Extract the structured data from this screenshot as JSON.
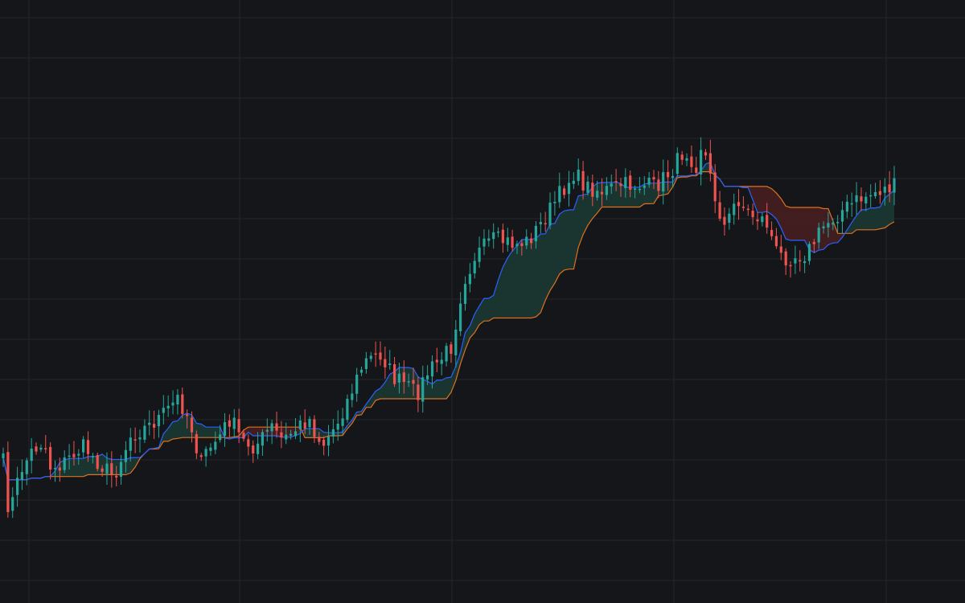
{
  "theme": {
    "background": "#151619",
    "grid": "#22252b",
    "up": "#26a69a",
    "down": "#ef5350",
    "fast_line": "#2962ff",
    "slow_line": "#e0701f",
    "bull_cloud": "#1b3a35",
    "bear_cloud": "#4a1f22"
  },
  "chart_data": {
    "type": "candlestick",
    "title": "",
    "xlabel": "",
    "ylabel": "",
    "bar_count": 190,
    "grid": true,
    "price_range": [
      0,
      750
    ],
    "series": [
      {
        "kind": "candles"
      },
      {
        "kind": "line",
        "role": "fast",
        "color": "#2962ff"
      },
      {
        "kind": "line",
        "role": "slow",
        "color": "#e0701f"
      },
      {
        "kind": "cloud",
        "between": [
          "fast",
          "slow"
        ]
      }
    ],
    "anchors": [
      [
        0,
        575
      ],
      [
        2,
        640
      ],
      [
        6,
        585
      ],
      [
        10,
        560
      ],
      [
        14,
        548
      ],
      [
        16,
        580
      ],
      [
        20,
        578
      ],
      [
        24,
        565
      ],
      [
        28,
        555
      ],
      [
        30,
        565
      ],
      [
        34,
        580
      ],
      [
        38,
        592
      ],
      [
        44,
        540
      ],
      [
        50,
        530
      ],
      [
        56,
        512
      ],
      [
        60,
        495
      ],
      [
        64,
        522
      ],
      [
        68,
        578
      ],
      [
        70,
        560
      ],
      [
        74,
        545
      ],
      [
        78,
        520
      ],
      [
        82,
        548
      ],
      [
        86,
        555
      ],
      [
        88,
        550
      ],
      [
        92,
        530
      ],
      [
        96,
        548
      ],
      [
        100,
        535
      ],
      [
        105,
        520
      ],
      [
        108,
        545
      ],
      [
        110,
        552
      ],
      [
        114,
        530
      ],
      [
        118,
        500
      ],
      [
        124,
        450
      ],
      [
        130,
        440
      ],
      [
        134,
        470
      ],
      [
        138,
        478
      ],
      [
        142,
        490
      ],
      [
        146,
        462
      ],
      [
        150,
        448
      ],
      [
        154,
        430
      ],
      [
        158,
        350
      ],
      [
        162,
        318
      ],
      [
        168,
        298
      ],
      [
        172,
        300
      ],
      [
        176,
        304
      ],
      [
        180,
        300
      ],
      [
        184,
        282
      ],
      [
        190,
        248
      ],
      [
        196,
        215
      ],
      [
        200,
        232
      ],
      [
        206,
        238
      ],
      [
        212,
        230
      ],
      [
        218,
        230
      ],
      [
        224,
        232
      ],
      [
        230,
        210
      ],
      [
        234,
        185
      ],
      [
        238,
        205
      ],
      [
        240,
        175
      ],
      [
        244,
        240
      ],
      [
        248,
        285
      ],
      [
        252,
        245
      ],
      [
        256,
        265
      ],
      [
        262,
        275
      ],
      [
        266,
        318
      ],
      [
        270,
        320
      ],
      [
        276,
        315
      ],
      [
        282,
        280
      ],
      [
        288,
        262
      ],
      [
        294,
        248
      ],
      [
        300,
        238
      ],
      [
        306,
        232
      ]
    ]
  }
}
